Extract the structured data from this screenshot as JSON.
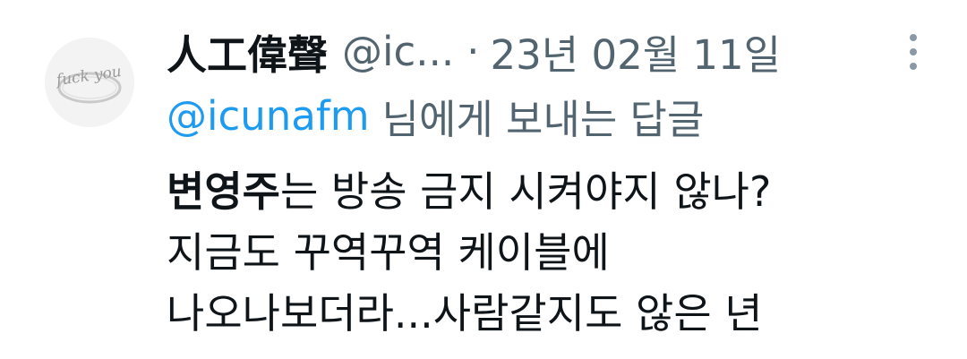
{
  "tweet": {
    "display_name": "人工偉聲",
    "handle": "@ic...",
    "separator": "·",
    "date": "23년 02월 11일",
    "reply_mention": "@icunafm",
    "reply_suffix": "님에게 보내는 답글",
    "body": {
      "line1_bold": "변영주",
      "line1_rest": "는 방송 금지 시켜야지 않나?",
      "line2": "지금도 꾸역꾸역 케이블에",
      "line3": "나오나보더라...사람같지도 않은 년"
    },
    "avatar_text": "fuck you"
  },
  "colors": {
    "text_primary": "#0f1419",
    "text_secondary": "#536471",
    "link": "#1d9bf0",
    "background": "#ffffff"
  },
  "icons": {
    "more": "more-vertical-icon"
  }
}
